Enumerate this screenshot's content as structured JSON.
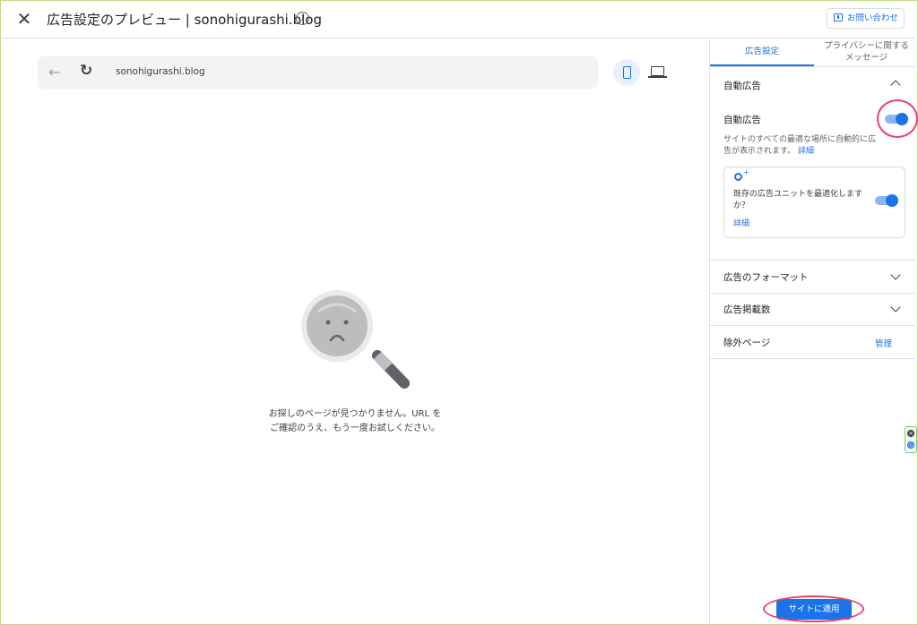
{
  "header": {
    "title": "広告設定のプレビュー | sonohigurashi.blog",
    "contact_label": "お問い合わせ"
  },
  "preview": {
    "url": "sonohigurashi.blog",
    "error_line1": "お探しのページが見つかりません。URL を",
    "error_line2": "ご確認のうえ、もう一度お試しください。"
  },
  "panel": {
    "tabs": [
      {
        "label": "広告設定",
        "active": true
      },
      {
        "label_line1": "プライバシーに関する",
        "label_line2": "メッセージ",
        "active": false
      }
    ],
    "auto_ads": {
      "section_title": "自動広告",
      "toggle_label": "自動広告",
      "toggle_on": true,
      "description": "サイトのすべての最適な場所に自動的に広告が表示されます。",
      "detail_link": "詳細",
      "sub": {
        "text": "既存の広告ユニットを最適化しますか？",
        "toggle_on": true,
        "detail_link": "詳細"
      }
    },
    "sections": [
      {
        "title": "広告のフォーマット"
      },
      {
        "title": "広告掲載数"
      }
    ],
    "excluded": {
      "title": "除外ページ",
      "action": "管理"
    },
    "apply_label": "サイトに適用"
  },
  "colors": {
    "accent": "#1a73e8",
    "highlight_ring": "#e8426f"
  }
}
